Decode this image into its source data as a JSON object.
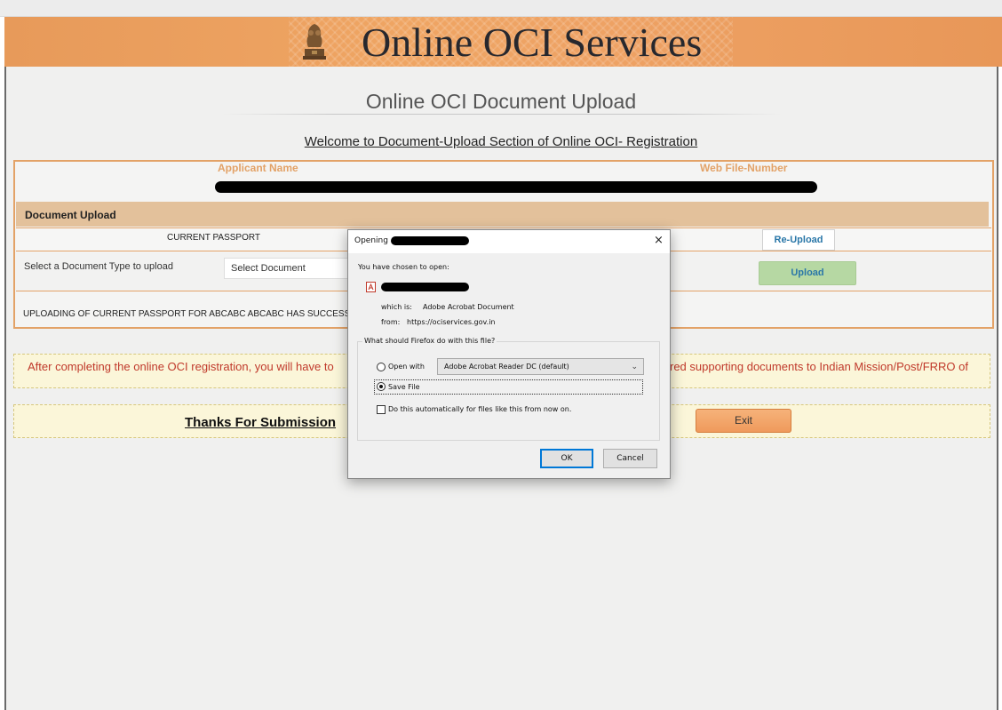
{
  "banner": {
    "title": "Online OCI Services"
  },
  "page": {
    "title": "Online OCI Document Upload",
    "welcome": "Welcome to Document-Upload Section of Online OCI- Registration"
  },
  "applicant": {
    "name_label": "Applicant Name",
    "webfile_label": "Web File-Number"
  },
  "document_upload": {
    "header": "Document Upload",
    "current_doc": "CURRENT PASSPORT",
    "reupload_label": "Re-Upload",
    "select_label": "Select a Document Type to upload",
    "select_value": "Select Document",
    "upload_label": "Upload",
    "status_message": "UPLOADING OF CURRENT PASSPORT FOR ABCABC ABCABC HAS SUCCESSF"
  },
  "notice": {
    "left_text": "After completing the online OCI registration, you will have to",
    "right_text": "red supporting documents to Indian Mission/Post/FRRO of"
  },
  "footer": {
    "thanks": "Thanks For Submission",
    "exit_label": "Exit"
  },
  "dialog": {
    "title": "Opening",
    "close": "×",
    "chosen_text": "You have chosen to open:",
    "which_label": "which is:",
    "which_value": "Adobe Acrobat Document",
    "from_label": "from:",
    "from_value": "https://ociservices.gov.in",
    "group_label": "What should Firefox do with this file?",
    "open_with_label": "Open with",
    "open_with_value": "Adobe Acrobat Reader DC  (default)",
    "save_file_label": "Save File",
    "auto_label": "Do this automatically for files like this from now on.",
    "ok_label": "OK",
    "cancel_label": "Cancel",
    "selected_option": "save-file"
  }
}
